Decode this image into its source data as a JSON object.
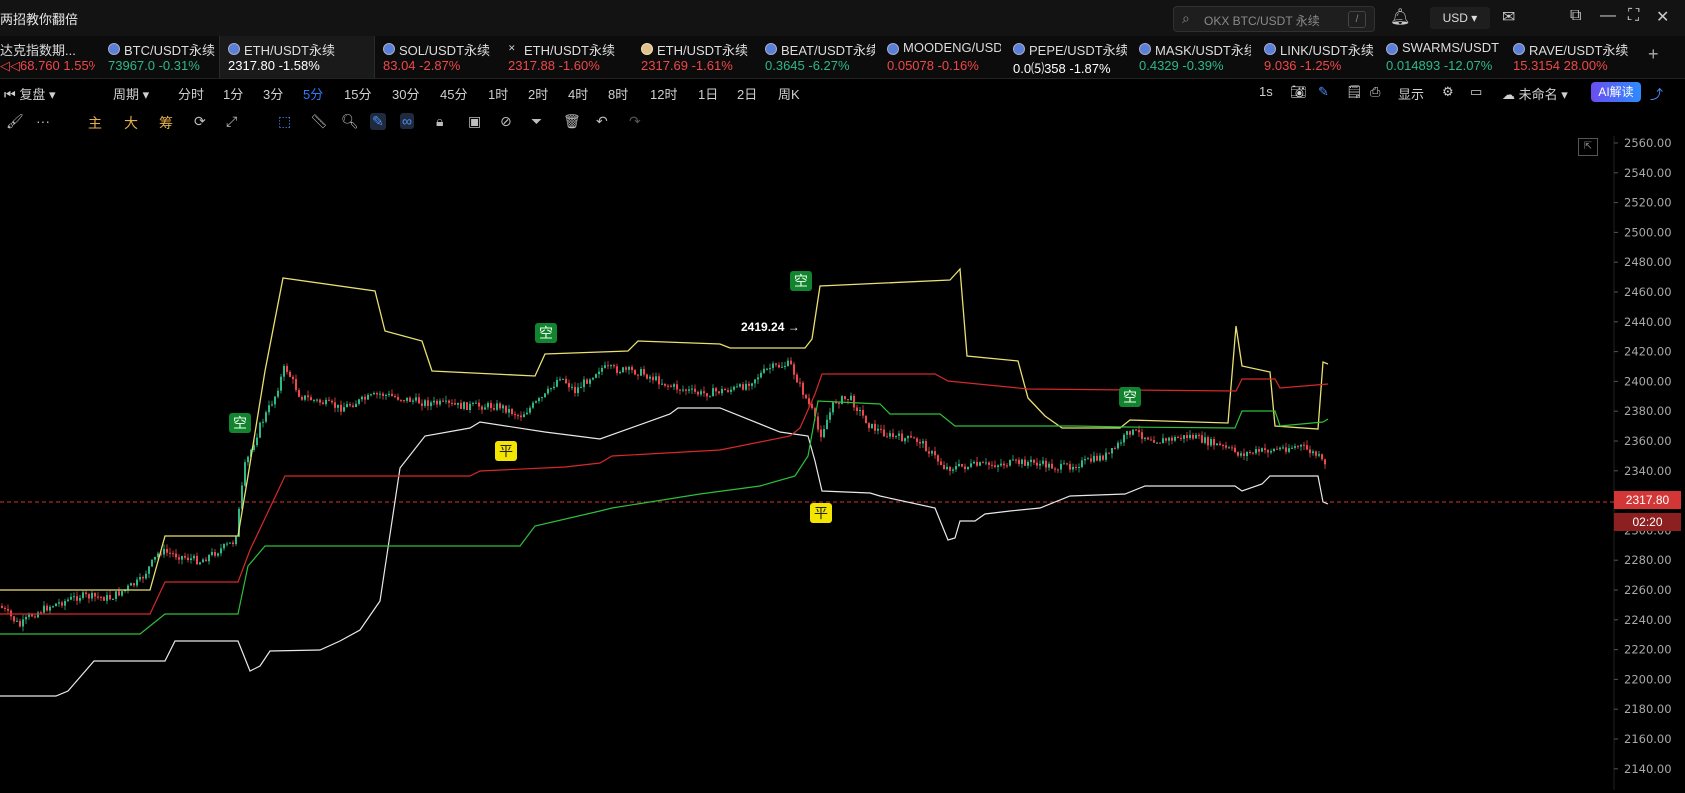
{
  "app": {
    "title": "两招教你翻倍"
  },
  "search": {
    "placeholder": "OKX BTC/USDT 永续",
    "shortcut": "/"
  },
  "topbar": {
    "currency": "USD ▾",
    "bell": "bell-icon",
    "mail": "mail-icon"
  },
  "tabs": [
    {
      "name": "达克指数期...",
      "price": "68.760",
      "change": "1.55%",
      "dir": "dn",
      "icon": "none"
    },
    {
      "name": "BTC/USDT永续",
      "price": "73967.0",
      "change": "-0.31%",
      "dir": "up",
      "icon": "coin"
    },
    {
      "name": "ETH/USDT永续",
      "price": "2317.80",
      "change": "-1.58%",
      "dir": "wh",
      "icon": "coin",
      "active": true
    },
    {
      "name": "SOL/USDT永续",
      "price": "83.04",
      "change": "-2.87%",
      "dir": "dn",
      "icon": "coin"
    },
    {
      "name": "ETH/USDT永续",
      "price": "2317.88",
      "change": "-1.60%",
      "dir": "dn",
      "icon": "cross"
    },
    {
      "name": "ETH/USDT永续",
      "price": "2317.69",
      "change": "-1.61%",
      "dir": "dn",
      "icon": "gold"
    },
    {
      "name": "BEAT/USDT永续",
      "price": "0.3645",
      "change": "-6.27%",
      "dir": "up",
      "icon": "coin"
    },
    {
      "name": "MOODENG/USDT",
      "price": "0.05078",
      "change": "-0.16%",
      "dir": "dn",
      "icon": "coin"
    },
    {
      "name": "PEPE/USDT永续",
      "price": "0.0⑸358",
      "change": "-1.87%",
      "dir": "wh",
      "icon": "coin"
    },
    {
      "name": "MASK/USDT永续",
      "price": "0.4329",
      "change": "-0.39%",
      "dir": "up",
      "icon": "coin"
    },
    {
      "name": "LINK/USDT永续",
      "price": "9.036",
      "change": "-1.25%",
      "dir": "dn",
      "icon": "coin"
    },
    {
      "name": "SWARMS/USDT",
      "price": "0.014893",
      "change": "-12.07%",
      "dir": "up",
      "icon": "coin"
    },
    {
      "name": "RAVE/USDT永续",
      "price": "15.3154",
      "change": "28.00%",
      "dir": "dn",
      "icon": "coin"
    }
  ],
  "periods": {
    "replay": "复盘",
    "cycle": "周期",
    "items": [
      "分时",
      "1分",
      "3分",
      "5分",
      "15分",
      "30分",
      "45分",
      "1时",
      "2时",
      "4时",
      "8时",
      "12时",
      "1日",
      "2日",
      "周K"
    ],
    "selected": "5分",
    "interval": "1s",
    "display": "显示",
    "layout_name": "未命名",
    "ai": "AI解读"
  },
  "toolbar": {
    "main": "主",
    "big": "大",
    "chips": "筹"
  },
  "chart": {
    "current_price": "2317.80",
    "countdown": "02:20",
    "annotation": "2419.24",
    "signals": {
      "short": "空",
      "close": "平"
    },
    "y_ticks": [
      "2560.00",
      "2540.00",
      "2520.00",
      "2500.00",
      "2480.00",
      "2460.00",
      "2440.00",
      "2420.00",
      "2400.00",
      "2380.00",
      "2360.00",
      "2340.00",
      "2320.00",
      "2300.00",
      "2280.00",
      "2260.00",
      "2240.00",
      "2220.00",
      "2200.00",
      "2180.00",
      "2160.00",
      "2140.00"
    ],
    "colors": {
      "up": "#2eb886",
      "down": "#f0474a",
      "yellow": "#e8e070",
      "red": "#d42a2a",
      "green": "#2fbf3a",
      "white": "#e8e8e8"
    }
  }
}
